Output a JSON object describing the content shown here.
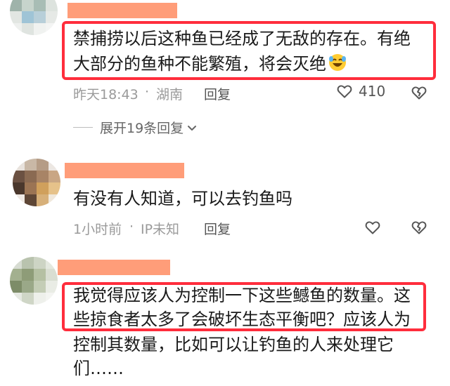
{
  "comments": [
    {
      "text_lines": [
        "禁捕捞以后这种鱼已经成了无敌的存在。有绝",
        "大部分的鱼种不能繁殖，将会灭绝"
      ],
      "emoji": "rolling-laughing-emoji",
      "time": "昨天18:43",
      "separator": "·",
      "location": "湖南",
      "reply_label": "回复",
      "like_count": "410"
    },
    {
      "text_lines": [
        "有没有人知道，可以去钓鱼吗"
      ],
      "time": "1小时前",
      "separator": "·",
      "location": "IP未知",
      "reply_label": "回复"
    },
    {
      "text_lines": [
        "我觉得应该人为控制一下这些鳡鱼的数量。这",
        "些掠食者太多了会破坏生态平衡吧？应该人为",
        "控制其数量，比如可以让钓鱼的人来处理它",
        "们……"
      ]
    }
  ],
  "expand_replies_label": "展开19条回复",
  "colors": {
    "highlight_border": "#ff2d3c",
    "redaction": "#ff8c62",
    "meta_text": "#9a9a9a"
  },
  "icons": [
    "heart-icon",
    "broken-heart-icon",
    "chevron-down-icon"
  ]
}
